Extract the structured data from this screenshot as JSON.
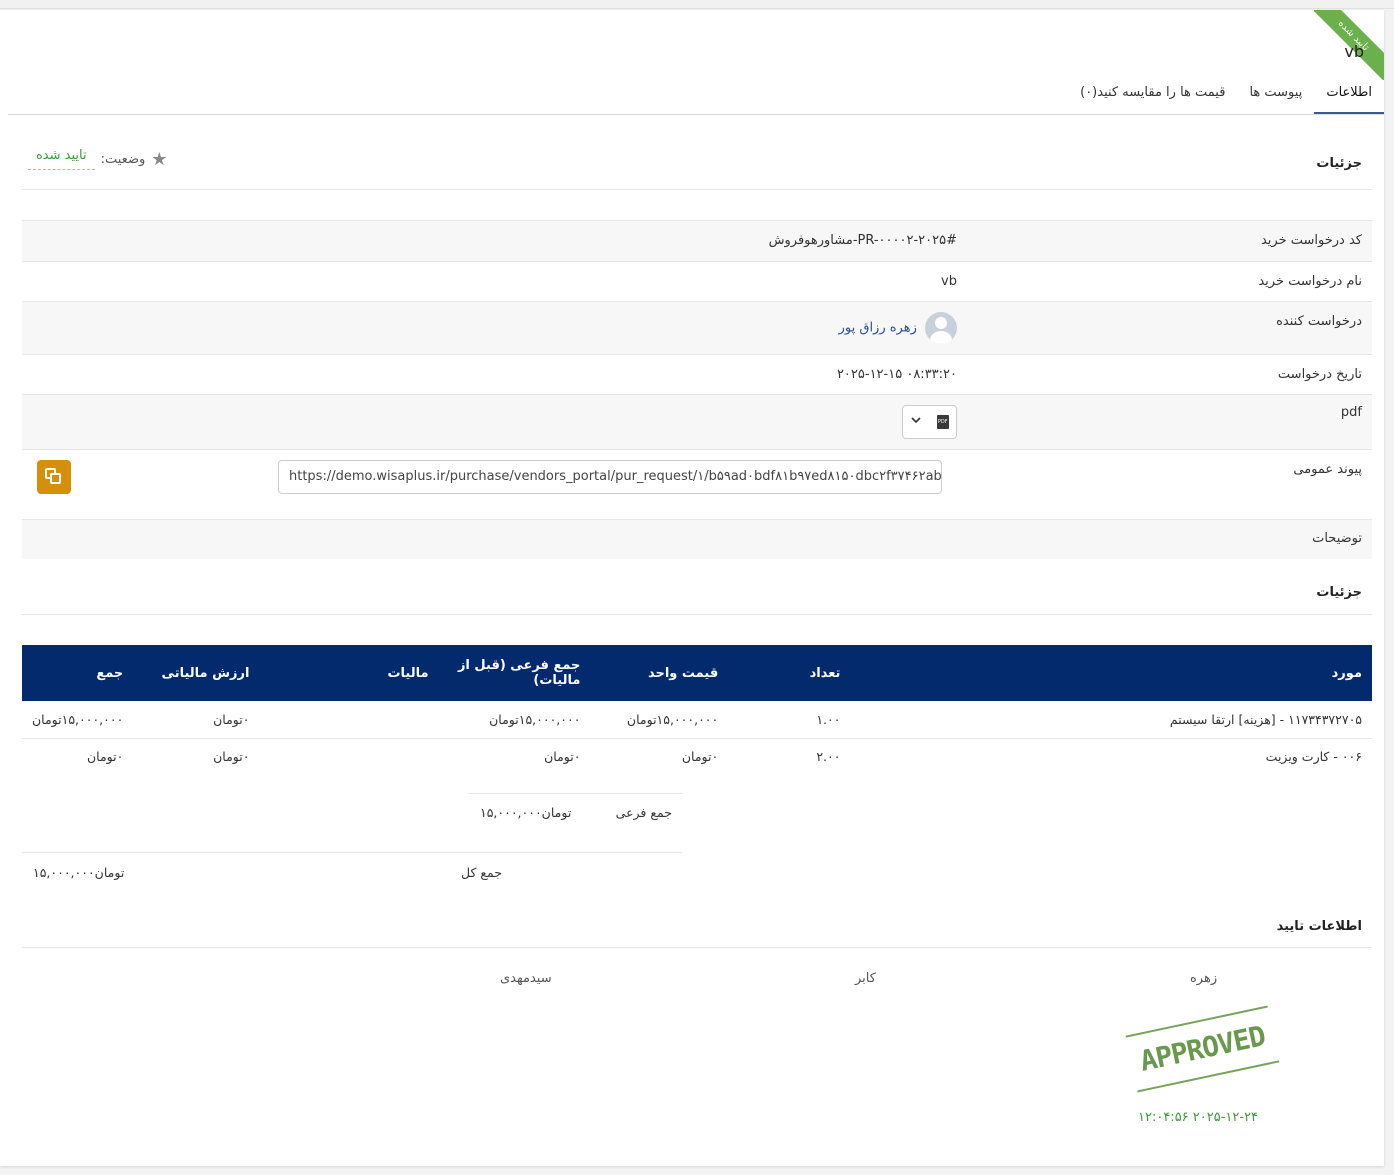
{
  "ribbon": "تایید شده",
  "title": "vb",
  "tabs": [
    "اطلاعات",
    "پیوست ها",
    "قیمت ها را مقایسه کنید(۰)"
  ],
  "details_title": "جزئیات",
  "status": {
    "label": "وضعیت:",
    "value": "تایید شده"
  },
  "fields": {
    "code_label": "کد درخواست خرید",
    "code_value": "#PR-۰۰۰۰۲-۲۰۲۵-مشاورهوفروش",
    "name_label": "نام درخواست خرید",
    "name_value": "vb",
    "requester_label": "درخواست کننده",
    "requester_value": "زهره رزاق پور",
    "date_label": "تاریخ درخواست",
    "date_value": "۰۸:۳۳:۲۰ ۲۰۲۵-۱۲-۱۵",
    "pdf_label": "pdf",
    "link_label": "پیوند عمومی",
    "link_value": "https://demo.wisaplus.ir/purchase/vendors_portal/pur_request/۱/b۵۹ad۰bdf۸۱b۹۷ed۸۱۵۰dbc۲f۳۷۴۶۲ab",
    "notes_label": "توضیحات"
  },
  "items_title": "جزئیات",
  "table": {
    "headers": [
      "مورد",
      "تعداد",
      "قیمت واحد",
      "جمع فرعی (قبل از مالیات)",
      "مالیات",
      "ارزش مالیاتی",
      "جمع"
    ],
    "rows": [
      [
        "۱۱۷۳۴۳۷۲۷۰۵ - [هزینه] ارتقا سیستم",
        "۱.۰۰",
        "۱۵,۰۰۰,۰۰۰تومان",
        "۱۵,۰۰۰,۰۰۰تومان",
        "",
        "۰تومان",
        "۱۵,۰۰۰,۰۰۰تومان"
      ],
      [
        "۰۰۶ - کارت ویزیت",
        "۲.۰۰",
        "۰تومان",
        "۰تومان",
        "",
        "۰تومان",
        "۰تومان"
      ]
    ]
  },
  "subtotal": {
    "label": "جمع فرعی",
    "value": "۱۵,۰۰۰,۰۰۰تومان"
  },
  "total": {
    "label": "جمع کل",
    "value": "۱۵,۰۰۰,۰۰۰تومان"
  },
  "approval": {
    "title": "اطلاعات تایید",
    "names": [
      "زهره",
      "کابر",
      "سیدمهدی"
    ],
    "stamp": "APPROVED",
    "date": "۱۲:۰۴:۵۶ ۲۰۲۵-۱۲-۲۴"
  }
}
